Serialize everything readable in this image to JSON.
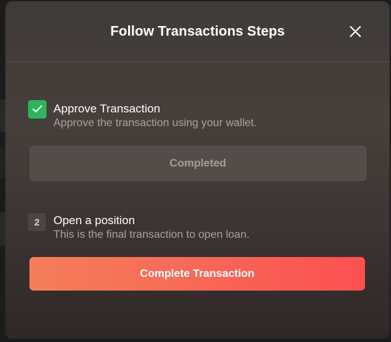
{
  "modal": {
    "title": "Follow Transactions Steps",
    "close_icon": "close-icon"
  },
  "steps": [
    {
      "indicator": "check",
      "title": "Approve Transaction",
      "description": "Approve the transaction using your wallet.",
      "button_label": "Completed",
      "status": "completed"
    },
    {
      "indicator": "2",
      "title": "Open a position",
      "description": "This is the final transaction to open loan.",
      "button_label": "Complete Transaction",
      "status": "pending"
    }
  ],
  "colors": {
    "accent_start": "#f57e5a",
    "accent_end": "#fc4f52",
    "success": "#2fb35b"
  }
}
